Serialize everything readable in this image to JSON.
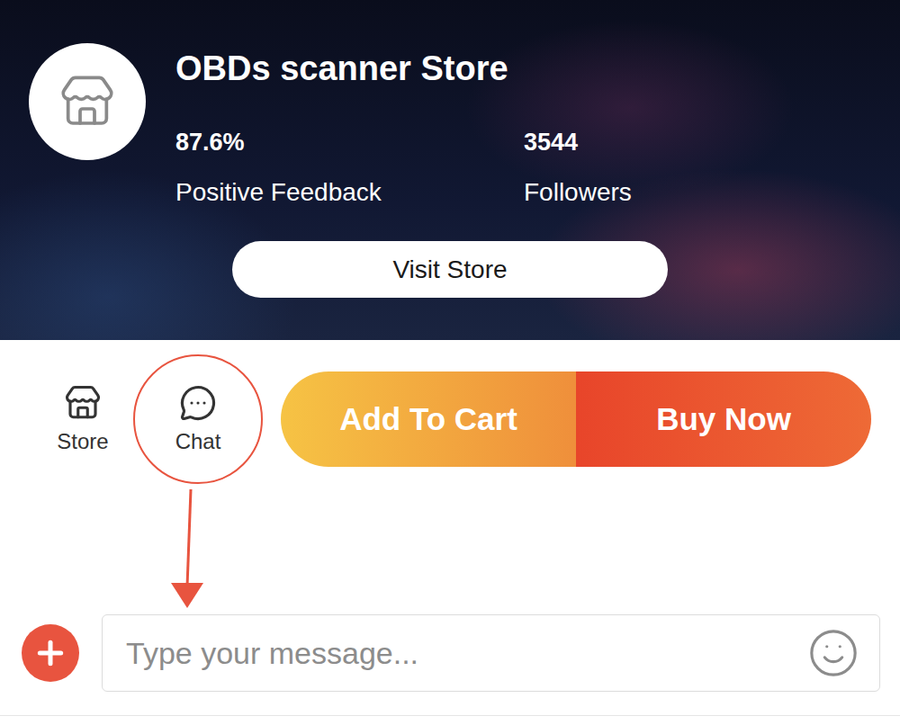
{
  "store": {
    "name": "OBDs scanner Store",
    "stats": [
      {
        "value": "87.6%",
        "label": "Positive Feedback"
      },
      {
        "value": "3544",
        "label": "Followers"
      }
    ],
    "visit_button": "Visit Store"
  },
  "action_bar": {
    "links": [
      {
        "label": "Store",
        "highlighted": false
      },
      {
        "label": "Chat",
        "highlighted": true
      }
    ],
    "buttons": [
      {
        "label": "Add To Cart",
        "kind": "cart"
      },
      {
        "label": "Buy Now",
        "kind": "buy"
      }
    ]
  },
  "message_bar": {
    "placeholder": "Type your message..."
  }
}
